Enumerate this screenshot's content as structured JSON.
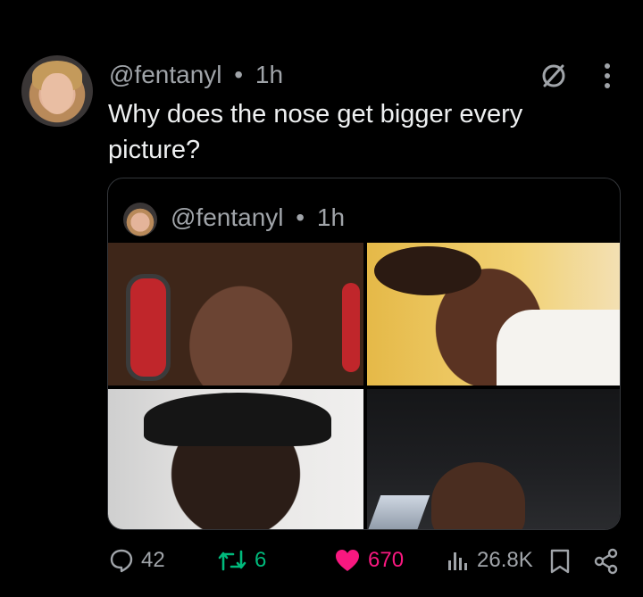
{
  "tweet": {
    "handle": "@fentanyl",
    "separator": "•",
    "time": "1h",
    "text": "Why does the nose get bigger every picture?",
    "mute_icon": "no-symbol-icon",
    "more_icon": "vertical-ellipsis-icon"
  },
  "quoted_tweet": {
    "handle": "@fentanyl",
    "separator": "•",
    "time": "1h",
    "photos": [
      {
        "name": "photo-1"
      },
      {
        "name": "photo-2"
      },
      {
        "name": "photo-3"
      },
      {
        "name": "photo-4"
      }
    ]
  },
  "actions": {
    "reply_count": "42",
    "retweet_count": "6",
    "like_count": "670",
    "view_count": "26.8K",
    "colors": {
      "retweet": "#00ba7c",
      "like": "#f91880",
      "muted": "#a0a4a9"
    }
  }
}
